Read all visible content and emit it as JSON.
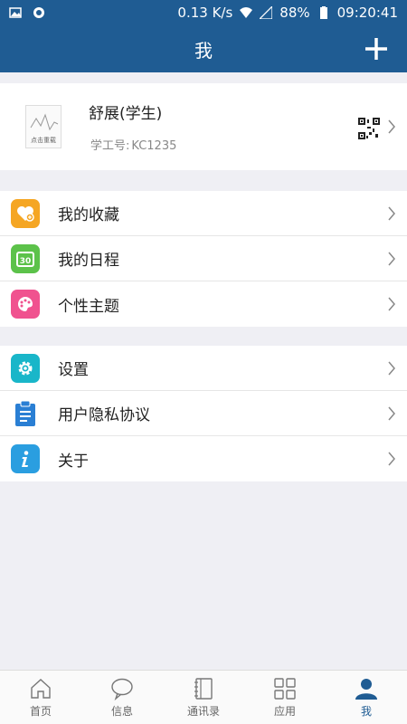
{
  "status_bar": {
    "speed": "0.13 K/s",
    "battery": "88%",
    "time": "09:20:41"
  },
  "header": {
    "title": "我"
  },
  "profile": {
    "name": "舒展(学生)",
    "id_label": "学工号:",
    "id_value": "KC1235",
    "avatar_caption": "点击重载"
  },
  "menu_group_1": [
    {
      "label": "我的收藏",
      "icon": "favorites-heart-icon",
      "color": "#f5a623"
    },
    {
      "label": "我的日程",
      "icon": "calendar-30-icon",
      "color": "#5cc24a"
    },
    {
      "label": "个性主题",
      "icon": "palette-icon",
      "color": "#f0528f"
    }
  ],
  "menu_group_2": [
    {
      "label": "设置",
      "icon": "gear-icon",
      "color": "#19b6c9"
    },
    {
      "label": "用户隐私协议",
      "icon": "clipboard-icon",
      "color": "#2a7fd4"
    },
    {
      "label": "关于",
      "icon": "info-icon",
      "color": "#2a9ee0"
    }
  ],
  "tabs": [
    {
      "label": "首页",
      "icon": "home-icon"
    },
    {
      "label": "信息",
      "icon": "chat-bubble-icon"
    },
    {
      "label": "通讯录",
      "icon": "address-book-icon"
    },
    {
      "label": "应用",
      "icon": "apps-grid-icon"
    },
    {
      "label": "我",
      "icon": "person-icon",
      "active": true
    }
  ]
}
